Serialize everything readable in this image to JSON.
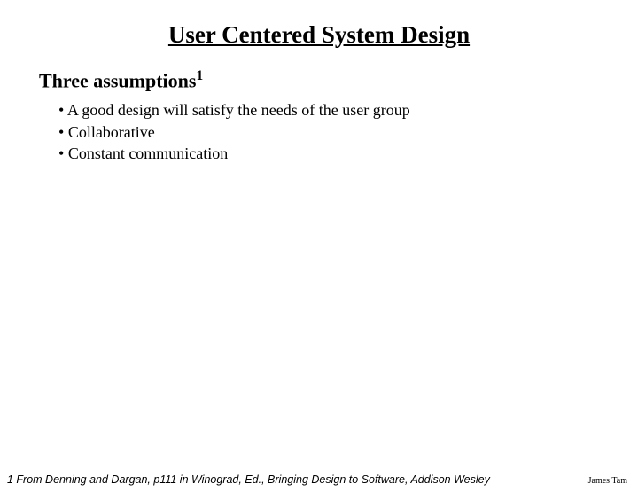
{
  "title": "User Centered System Design",
  "subheading": "Three assumptions",
  "subheading_super": "1",
  "bullets": [
    "A good design will satisfy the needs of the user group",
    "Collaborative",
    "Constant communication"
  ],
  "footnote": "1 From Denning and Dargan, p111 in Winograd, Ed., Bringing Design to Software, Addison Wesley",
  "author": "James Tam"
}
